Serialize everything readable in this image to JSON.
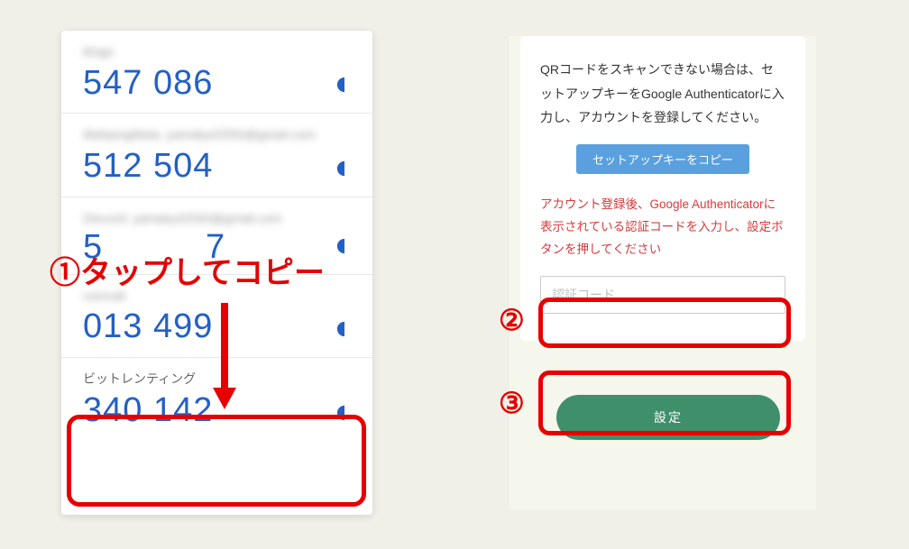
{
  "annotations": {
    "step1_label": "①タップしてコピー",
    "step2_marker": "②",
    "step3_marker": "③"
  },
  "authenticator": {
    "accounts": [
      {
        "label": "bingo",
        "label_blurred": true,
        "code": "547 086"
      },
      {
        "label": "MahjongMeta: yamaky42550@gmail.com",
        "label_blurred": true,
        "code": "512 504"
      },
      {
        "label": "Discord: yamaky42550@gmail.com",
        "label_blurred": true,
        "code": "5.. ..7",
        "code_partial": true,
        "code_left": "5",
        "code_right": "7"
      },
      {
        "label": "coincall",
        "label_blurred": true,
        "code": "013 499"
      },
      {
        "label": "ビットレンティング",
        "label_blurred": false,
        "code": "340 142",
        "highlighted": true
      }
    ]
  },
  "setup": {
    "instruction": "QRコードをスキャンできない場合は、セットアップキーをGoogle Authenticatorに入力し、アカウントを登録してください。",
    "copy_key_button": "セットアップキーをコピー",
    "warning": "アカウント登録後、Google Authenticatorに表示されている認証コードを入力し、設定ボタンを押してください",
    "code_input_placeholder": "認証コード",
    "submit_button": "設定"
  },
  "colors": {
    "code_blue": "#2360c5",
    "annotation_red": "#e60000",
    "button_blue": "#5aa0de",
    "button_green": "#3f8f6b",
    "warning_red": "#d93a3a"
  }
}
